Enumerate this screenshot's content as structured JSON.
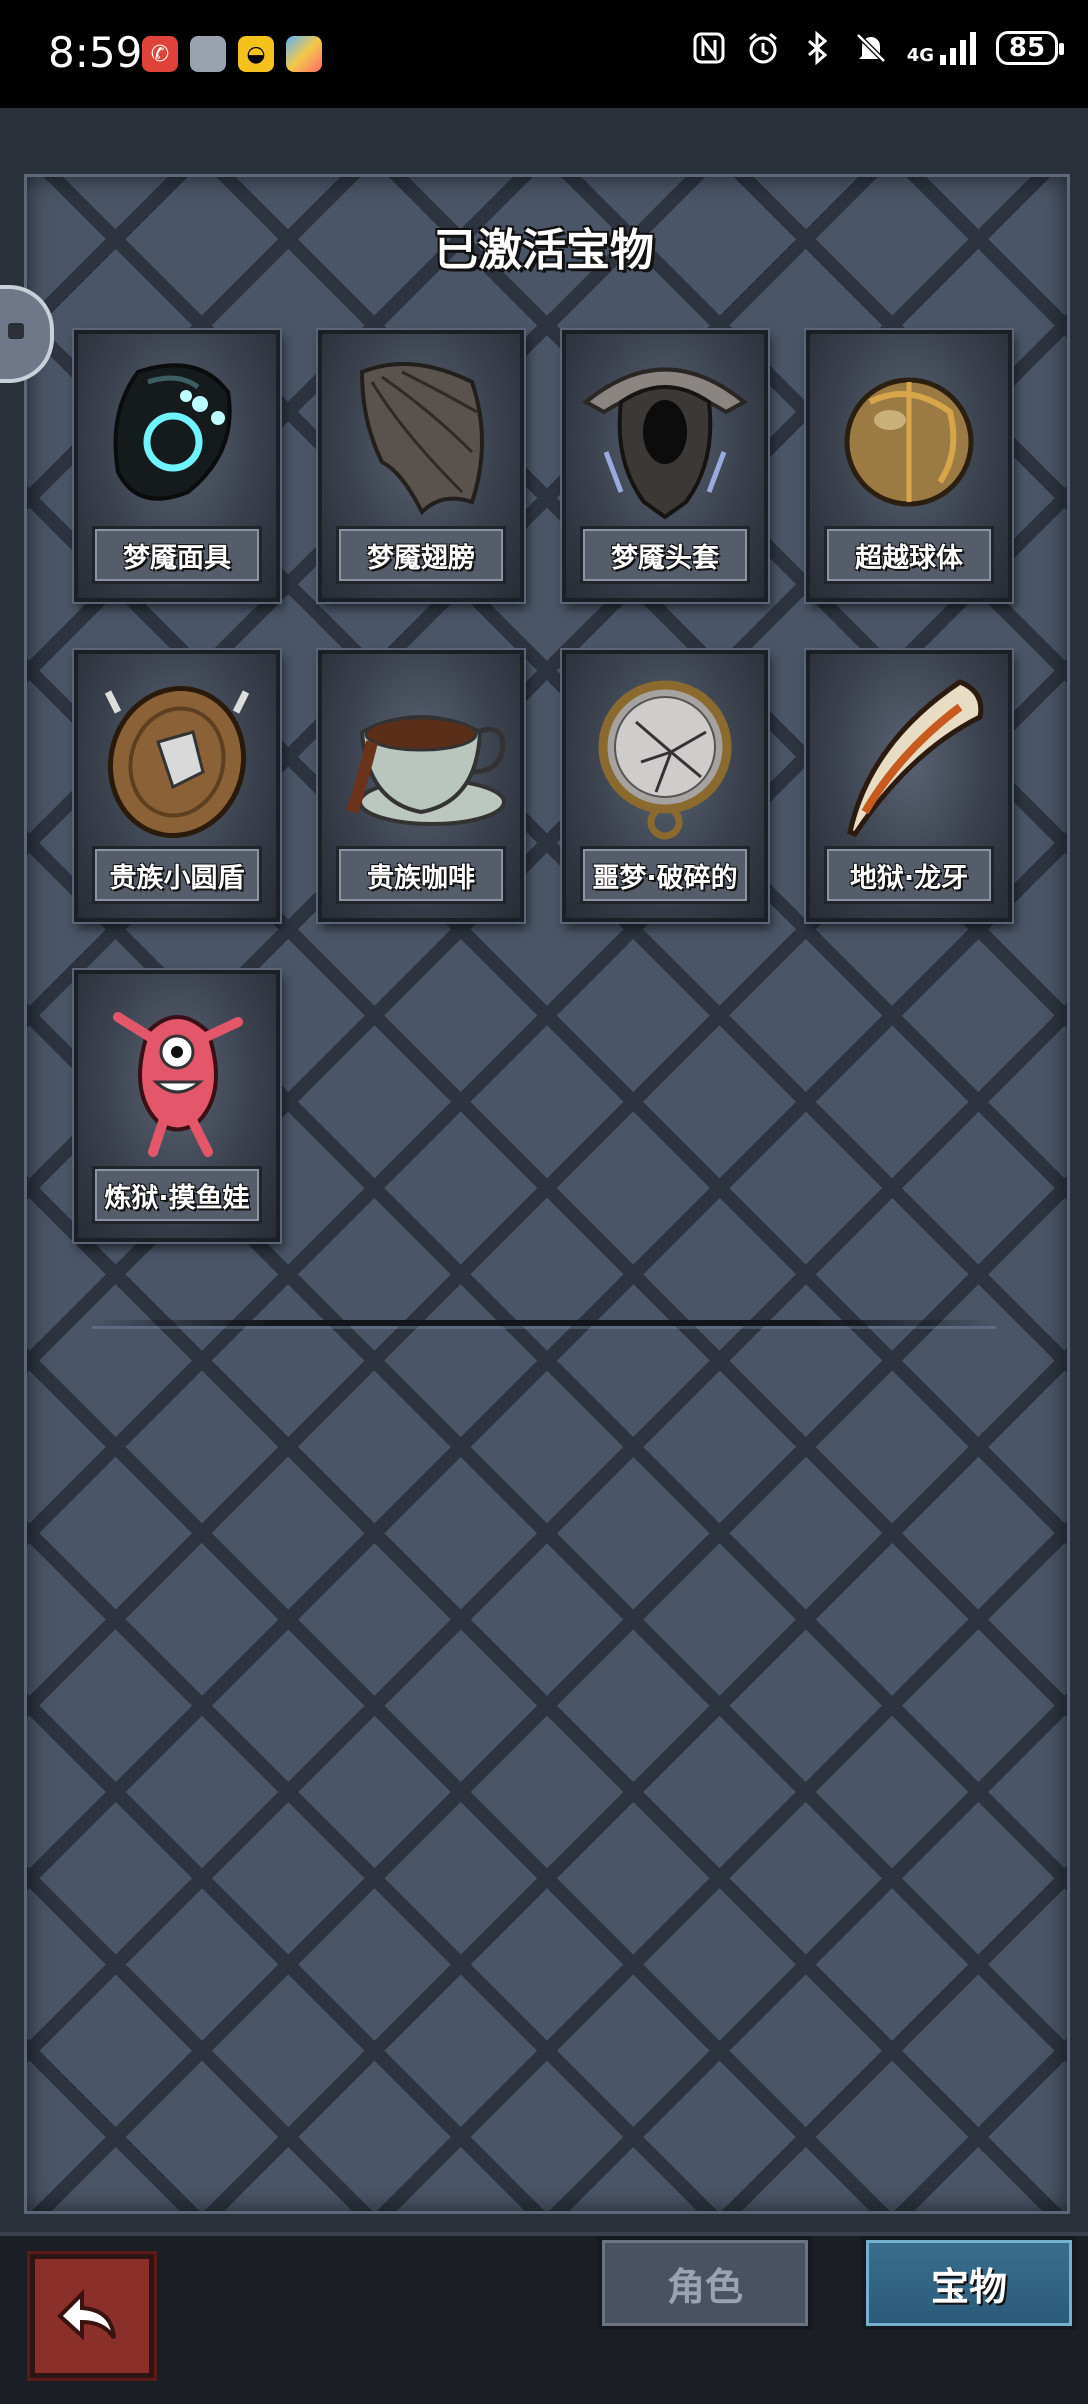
{
  "status_bar": {
    "time": "8:59",
    "network": "4G",
    "battery": "85"
  },
  "page": {
    "title": "已激活宝物"
  },
  "items": [
    {
      "name": "梦魇面具",
      "icon": "nightmare-mask-icon"
    },
    {
      "name": "梦魇翅膀",
      "icon": "nightmare-wing-icon"
    },
    {
      "name": "梦魇头套",
      "icon": "nightmare-helmet-icon"
    },
    {
      "name": "超越球体",
      "icon": "transcend-sphere-icon"
    },
    {
      "name": "贵族小圆盾",
      "icon": "noble-buckler-icon"
    },
    {
      "name": "贵族咖啡",
      "icon": "noble-coffee-icon"
    },
    {
      "name": "噩梦·破碎的",
      "icon": "broken-pocket-watch-icon"
    },
    {
      "name": "地狱·龙牙",
      "icon": "dragon-fang-icon"
    },
    {
      "name": "炼狱·摸鱼娃",
      "icon": "pink-doll-icon"
    }
  ],
  "bottom_nav": {
    "back_icon": "back-arrow-icon",
    "tab_role": "角色",
    "tab_treasure": "宝物"
  },
  "colors": {
    "panel_bg": "#4a5567",
    "back_button": "#8b2f2a",
    "active_tab": "#2a5a7a"
  }
}
